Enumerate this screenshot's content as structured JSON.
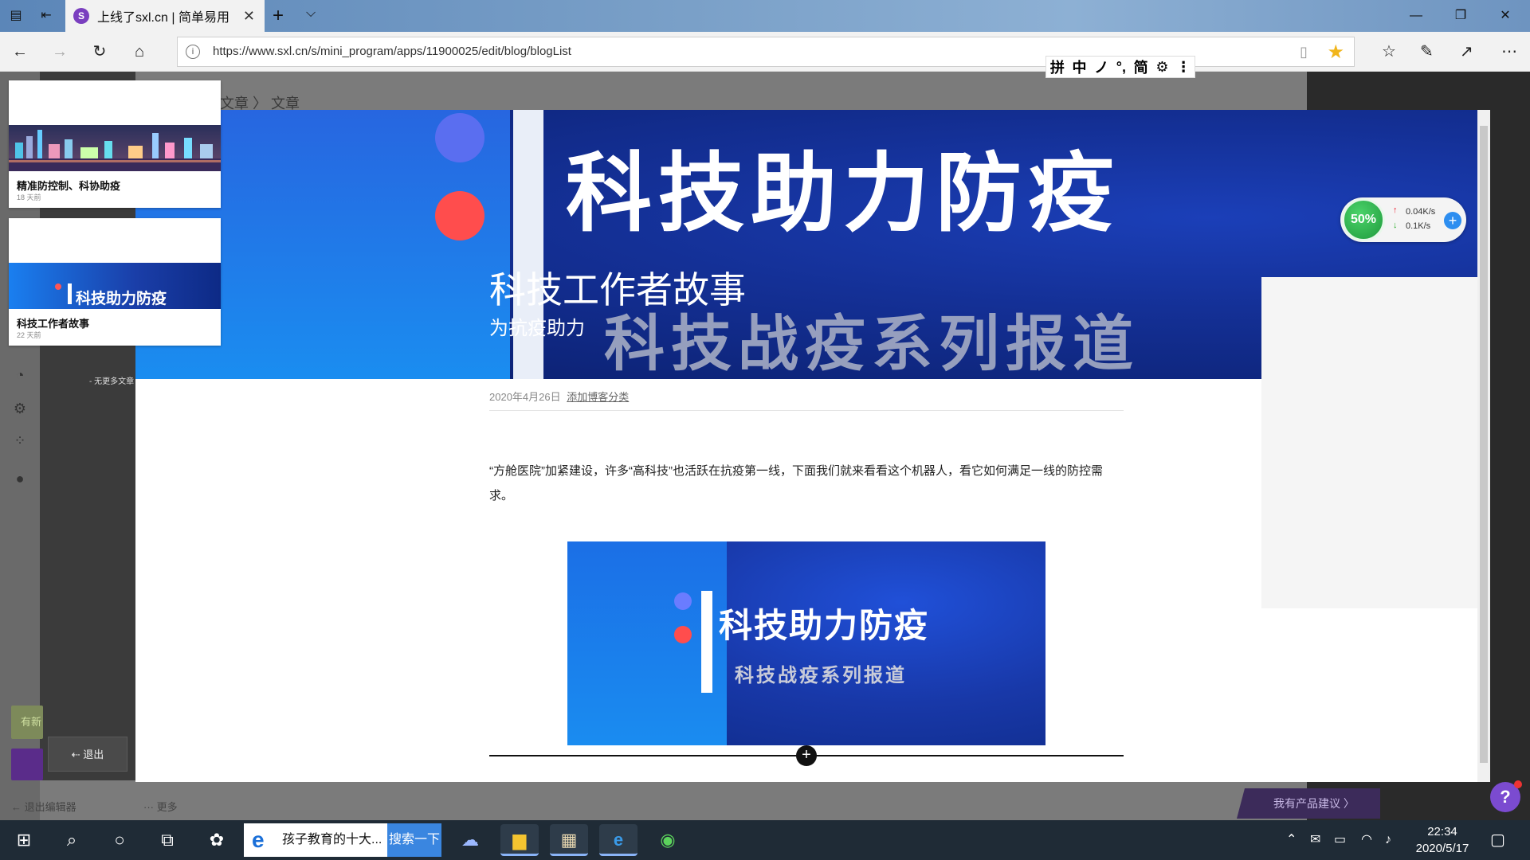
{
  "browser": {
    "tab_title": "上线了sxl.cn | 简单易用",
    "tab_favicon": "S",
    "url": "https://www.sxl.cn/s/mini_program/apps/11900025/edit/blog/blogList",
    "ime_toolbar": [
      "拼",
      "中",
      "ノ",
      "°,",
      "简",
      "⚙",
      "⋮"
    ]
  },
  "page": {
    "breadcrumb": "文章  〉 文章",
    "no_more_articles": "- 无更多文章",
    "logout_label": "退出",
    "exit_editor_label": "退出编辑器",
    "more_label": "··· 更多",
    "green_stub_label": "有新",
    "suggestion_label": "我有产品建议",
    "help_label": "?"
  },
  "cards": [
    {
      "title": "精准防控制、科协助疫",
      "time": "18 天前"
    },
    {
      "title": "科技工作者故事",
      "time": "22 天前",
      "thumb_text": "科技助力防疫"
    }
  ],
  "article": {
    "banner_text": "科技助力防疫",
    "banner_series": "科技战疫系列报道",
    "title": "科技工作者故事",
    "subtitle": "为抗疫助力",
    "date": "2020年4月26日",
    "category_link": "添加博客分类",
    "body": "“方舱医院”加紧建设，许多“高科技”也活跃在抗疫第一线，下面我们就来看看这个机器人，看它如何满足一线的防控需求。",
    "image_title": "科技助力防疫",
    "image_subtitle": "科技战疫系列报道",
    "add_block_label": "+"
  },
  "network_widget": {
    "percent": "50%",
    "upload": "0.04K/s",
    "download": "0.1K/s"
  },
  "taskbar": {
    "search_text": "孩子教育的十大...",
    "search_button": "搜索一下",
    "time": "22:34",
    "date": "2020/5/17"
  },
  "colors": {
    "accent": "#7b4bd0",
    "banner_blue": "#143096",
    "taskbar": "#1f2b36"
  }
}
